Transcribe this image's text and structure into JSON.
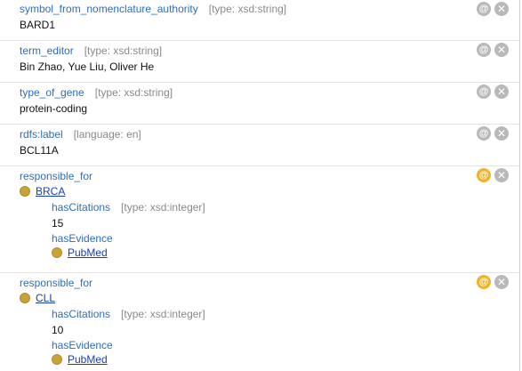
{
  "annotations": [
    {
      "property": "symbol_from_nomenclature_authority",
      "meta": "[type: xsd:string]",
      "value": "BARD1"
    },
    {
      "property": "term_editor",
      "meta": "[type: xsd:string]",
      "value": "Bin Zhao, Yue Liu, Oliver He"
    },
    {
      "property": "type_of_gene",
      "meta": "[type: xsd:string]",
      "value": "protein-coding"
    },
    {
      "property": "rdfs:label",
      "meta": "[language: en]",
      "value": "BCL11A"
    }
  ],
  "relations": [
    {
      "property": "responsible_for",
      "target": "BRCA",
      "citations_label": "hasCitations",
      "citations_meta": "[type: xsd:integer]",
      "citations_value": "15",
      "evidence_label": "hasEvidence",
      "evidence_target": "PubMed"
    },
    {
      "property": "responsible_for",
      "target": "CLL",
      "citations_label": "hasCitations",
      "citations_meta": "[type: xsd:integer]",
      "citations_value": "10",
      "evidence_label": "hasEvidence",
      "evidence_target": "PubMed"
    }
  ],
  "buttons": {
    "annotate_glyph": "@",
    "delete_glyph": "✕"
  },
  "colors": {
    "property": "#2f6db8",
    "link": "#1a3fb8",
    "active_annotate": "#f0b429",
    "individual_dot": "#c9a33a"
  }
}
